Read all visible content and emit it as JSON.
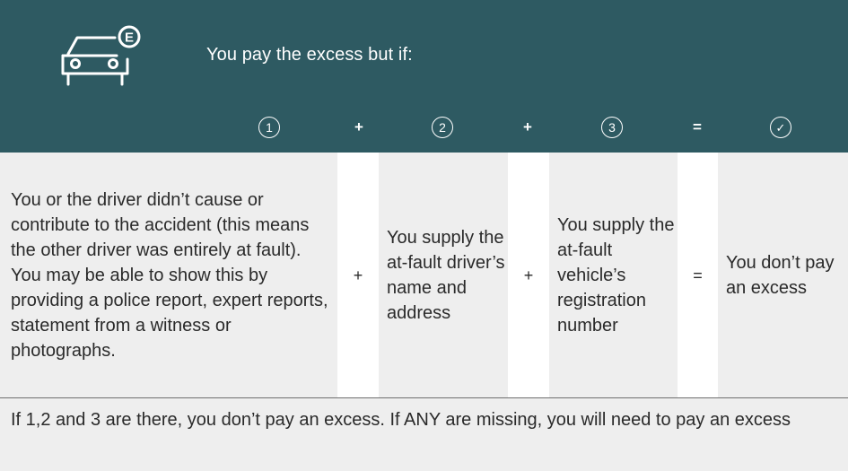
{
  "header": {
    "title": "You pay the excess but if:",
    "icon": "car-excess-icon",
    "icon_badge": "E",
    "steps": [
      {
        "symbol": "1"
      },
      {
        "op": "+"
      },
      {
        "symbol": "2"
      },
      {
        "op": "+"
      },
      {
        "symbol": "3"
      },
      {
        "op": "="
      },
      {
        "symbol": "✓"
      }
    ],
    "background_color": "#2e5a62"
  },
  "conditions": {
    "condition_1": "You or the driver didn’t cause or contribute to the accident (this means the other driver was entirely at fault). You may be able to show this by providing a police report, expert reports, statement from a witness or photographs.",
    "op_1": "+",
    "condition_2": "You supply the at-fault driver’s name and address",
    "op_2": "+",
    "condition_3": "You supply the at-fault vehicle’s registration number",
    "op_3": "=",
    "result": "You don’t pay an excess"
  },
  "footer": {
    "note": "If 1,2 and 3 are there, you don’t pay an excess. If ANY are missing, you will need to pay an excess"
  }
}
